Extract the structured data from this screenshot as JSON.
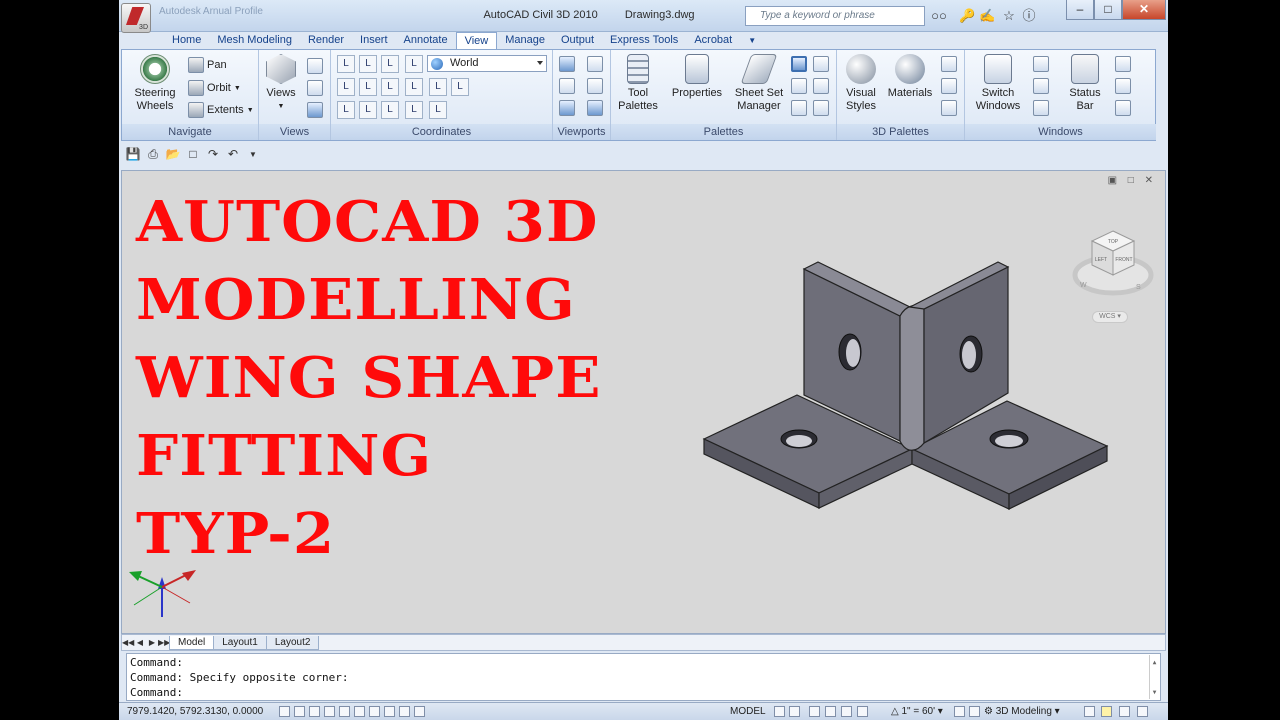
{
  "window": {
    "app_title": "AutoCAD Civil 3D 2010",
    "doc_title": "Drawing3.dwg",
    "faint_qat": "Autodesk Arnual Profile",
    "app_badge": "3D",
    "search_placeholder": "Type a keyword or phrase"
  },
  "tabs": [
    "Home",
    "Mesh Modeling",
    "Render",
    "Insert",
    "Annotate",
    "View",
    "Manage",
    "Output",
    "Express Tools",
    "Acrobat"
  ],
  "active_tab": "View",
  "ribbon": {
    "navigate": {
      "title": "Navigate",
      "steering_line1": "Steering",
      "steering_line2": "Wheels",
      "pan": "Pan",
      "orbit": "Orbit",
      "extents": "Extents"
    },
    "views": {
      "title": "Views",
      "label": "Views"
    },
    "coordinates": {
      "title": "Coordinates",
      "ucs_value": "World"
    },
    "viewports": {
      "title": "Viewports"
    },
    "palettes": {
      "title": "Palettes",
      "tool_palettes_l1": "Tool",
      "tool_palettes_l2": "Palettes",
      "properties": "Properties",
      "sheet_set_l1": "Sheet Set",
      "sheet_set_l2": "Manager"
    },
    "palettes3d": {
      "title": "3D Palettes",
      "visual_styles_l1": "Visual",
      "visual_styles_l2": "Styles",
      "materials": "Materials"
    },
    "windows": {
      "title": "Windows",
      "switch_l1": "Switch",
      "switch_l2": "Windows",
      "status_l1": "Status",
      "status_l2": "Bar"
    }
  },
  "overlay_title": [
    "AUTOCAD 3D",
    "MODELLING",
    "WING SHAPE",
    "FITTING",
    "TYP-2"
  ],
  "viewcube": {
    "top": "TOP",
    "left": "LEFT",
    "front": "FRONT",
    "w": "W",
    "s": "S",
    "wcs": "WCS"
  },
  "layout_tabs": [
    "Model",
    "Layout1",
    "Layout2"
  ],
  "command_lines": [
    "Command:",
    "Command: Specify opposite corner:",
    "Command:"
  ],
  "status": {
    "coords": "7979.1420, 5792.3130, 0.0000",
    "model": "MODEL",
    "scale": "1\" = 60'",
    "workspace": "3D Modeling"
  },
  "colors": {
    "overlay_text": "#ff0a0a",
    "part_fill": "#6e6e7a",
    "background": "#d8d8d8"
  }
}
